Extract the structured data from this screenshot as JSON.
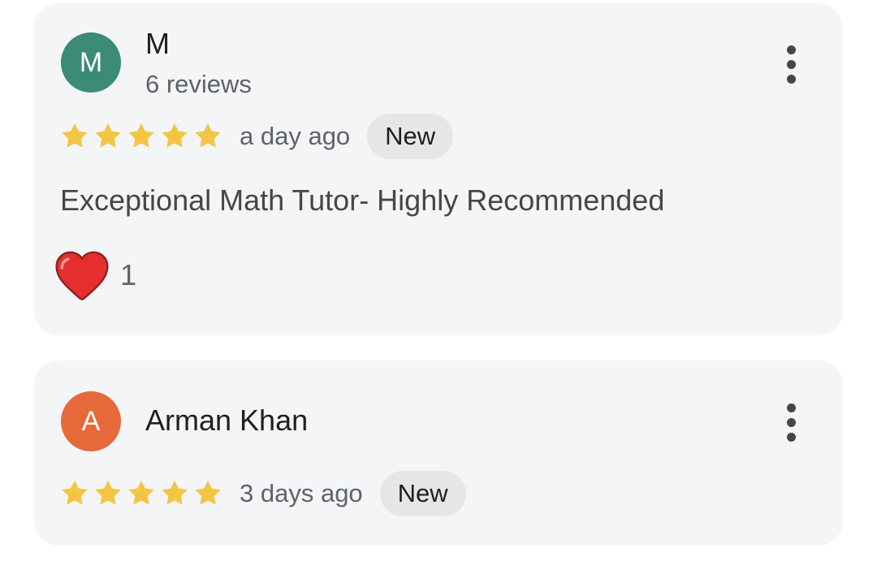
{
  "reviews": [
    {
      "avatar_letter": "M",
      "avatar_color": "#3b8b76",
      "name": "M",
      "review_count": "6 reviews",
      "rating": 5,
      "date": "a day ago",
      "badge": "New",
      "text": "Exceptional Math Tutor- Highly Recommended",
      "reaction": {
        "icon": "heart-icon",
        "count": "1"
      },
      "menu_icon": "more-vertical-icon"
    },
    {
      "avatar_letter": "A",
      "avatar_color": "#e5693a",
      "name": "Arman Khan",
      "rating": 5,
      "date": "3 days ago",
      "badge": "New",
      "menu_icon": "more-vertical-icon"
    }
  ],
  "colors": {
    "card_background": "#f3f5f7",
    "star": "#f4c542",
    "badge_background": "#e4e6e8",
    "heart": "#e52e2e"
  }
}
